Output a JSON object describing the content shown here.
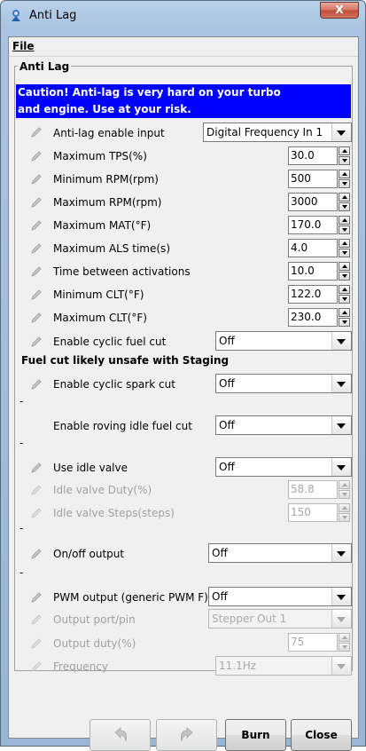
{
  "window": {
    "title": "Anti Lag",
    "close_glyph": "X",
    "menu_file": "File",
    "group_title": "Anti Lag"
  },
  "warning": {
    "line1": "Caution! Anti-lag is very hard on your turbo",
    "line2": "and engine. Use at your risk."
  },
  "fields": [
    {
      "label": "Anti-lag enable input",
      "type": "combo",
      "value": "Digital Frequency In 1"
    },
    {
      "label": "Maximum TPS(%)",
      "type": "spin",
      "value": "30.0"
    },
    {
      "label": "Minimum RPM(rpm)",
      "type": "spin",
      "value": "500"
    },
    {
      "label": "Maximum RPM(rpm)",
      "type": "spin",
      "value": "3000"
    },
    {
      "label": "Maximum MAT(°F)",
      "type": "spin",
      "value": "170.0"
    },
    {
      "label": "Maximum ALS time(s)",
      "type": "spin",
      "value": "4.0"
    },
    {
      "label": "Time between activations",
      "type": "spin",
      "value": "10.0"
    },
    {
      "label": "Minimum CLT(°F)",
      "type": "spin",
      "value": "122.0"
    },
    {
      "label": "Maximum CLT(°F)",
      "type": "spin",
      "value": "230.0"
    },
    {
      "label": "Enable cyclic fuel cut",
      "type": "combo",
      "value": "Off"
    }
  ],
  "staging_note": "Fuel cut likely unsafe with Staging",
  "lower": {
    "cyclic_spark": {
      "label": "Enable cyclic spark cut",
      "value": "Off"
    },
    "roving_idle": {
      "label": "Enable roving idle fuel cut",
      "value": "Off"
    },
    "idle_valve": {
      "label": "Use idle valve",
      "value": "Off"
    },
    "idle_duty": {
      "label": "Idle valve Duty(%)",
      "value": "58.8"
    },
    "idle_steps": {
      "label": "Idle valve Steps(steps)",
      "value": "150"
    },
    "onoff": {
      "label": "On/off output",
      "value": "Off"
    },
    "pwm": {
      "label": "PWM output (generic PWM F)",
      "value": "Off"
    },
    "port": {
      "label": "Output port/pin",
      "value": "Stepper Out 1"
    },
    "duty": {
      "label": "Output duty(%)",
      "value": "75"
    },
    "freq": {
      "label": "Frequency",
      "value": "11.1Hz"
    }
  },
  "separators": [
    "-",
    "-",
    "-",
    "-"
  ],
  "buttons": {
    "burn": "Burn",
    "close": "Close"
  },
  "icons": {
    "app": "wizard-icon",
    "field": "pencil-edit-icon",
    "undo": "undo-arrow-icon",
    "redo": "redo-arrow-icon"
  }
}
